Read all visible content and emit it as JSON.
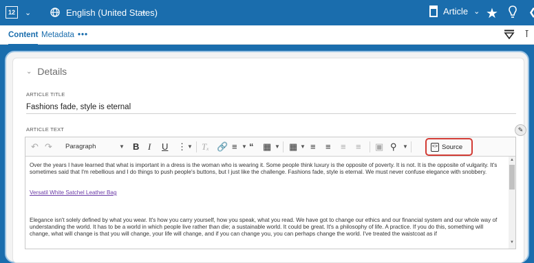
{
  "topbar": {
    "flag_glyph": "1⁢2",
    "language": "English (United States)",
    "item_type": "Article"
  },
  "tabs": {
    "content": "Content",
    "metadata": "Metadata",
    "more": "•••"
  },
  "details": {
    "heading": "Details"
  },
  "fields": {
    "article_title_label": "ARTICLE TITLE",
    "article_title_value": "Fashions fade, style is eternal",
    "article_text_label": "ARTICLE TEXT"
  },
  "toolbar": {
    "paragraph": "Paragraph",
    "source": "Source"
  },
  "editor": {
    "paragraph1": "Over the years I have learned that what is important in a dress is the woman who is wearing it. Some people think luxury is the opposite of poverty. It is not. It is the opposite of vulgarity. It's sometimes said that I'm rebellious and I do things to push people's buttons, but I just like the challenge. Fashions fade, style is eternal. We must never confuse elegance with snobbery.",
    "link": "Versatil White Satchel Leather Bag",
    "paragraph2": "Elegance isn't solely defined by what you wear. It's how you carry yourself, how you speak, what you read. We have got to change our ethics and our financial system and our whole way of understanding the world. It has to be a world in which people live rather than die; a sustainable world. It could be great. It's a philosophy of life. A practice. If you do this, something will change, what will change is that you will change, your life will change, and if you can change you, you can perhaps change the world. I've treated the waistcoat as if"
  },
  "colors": {
    "brand_blue": "#1a6dad",
    "highlight_red": "#d23a33",
    "link_purple": "#6a3aa6"
  },
  "icons": [
    "grid-icon",
    "globe-icon",
    "document-icon",
    "star-icon",
    "lightbulb-icon",
    "filter-icon",
    "comment-icon",
    "undo-icon",
    "redo-icon",
    "source-icon"
  ]
}
